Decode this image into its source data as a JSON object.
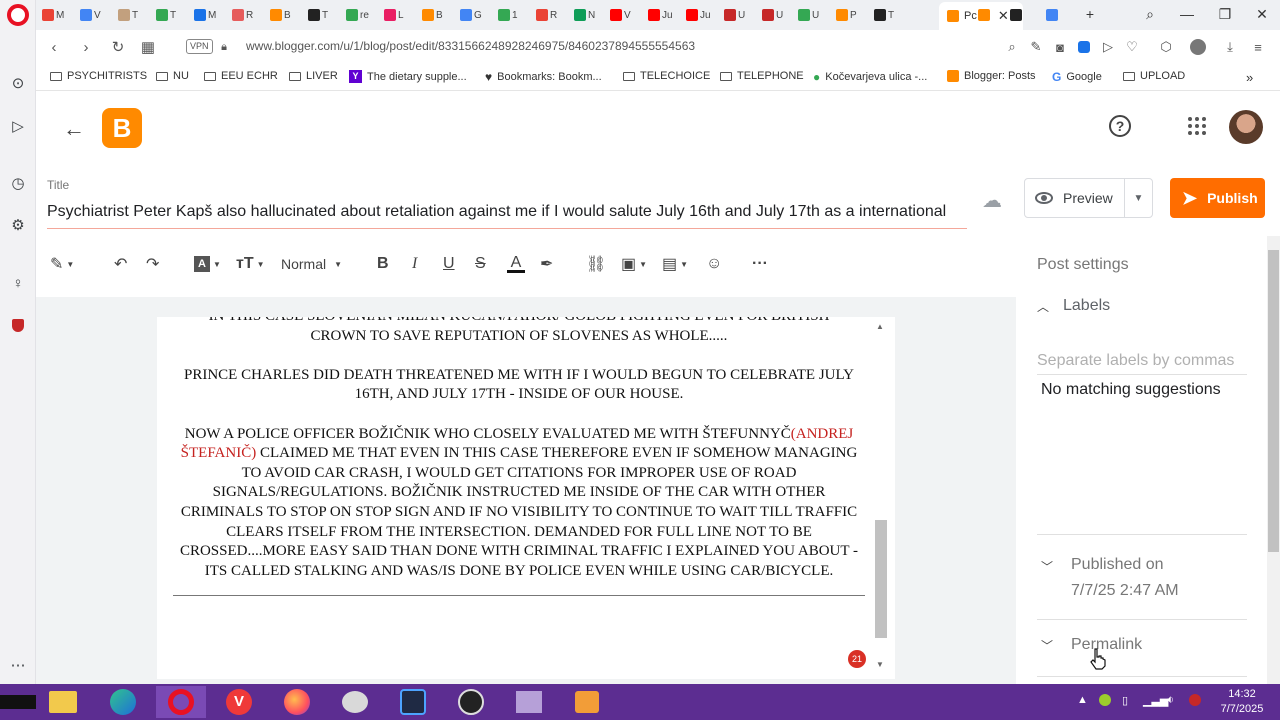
{
  "browser": {
    "active_tab_label": "Pc",
    "tab_short_labels": [
      "M",
      "V",
      "T",
      "T",
      "M",
      "R",
      "B",
      "T",
      "re",
      "L",
      "B",
      "G",
      "1",
      "R",
      "N",
      "V",
      "Ju",
      "Ju",
      "U",
      "U",
      "U",
      "P",
      "T"
    ],
    "url": "www.blogger.com/u/1/blog/post/edit/8331566248928246975/8460237894555554563",
    "vpn_label": "VPN",
    "bookmarks": [
      {
        "label": "PSYCHITRISTS",
        "icon": "folder-icon"
      },
      {
        "label": "NU",
        "icon": "folder-icon"
      },
      {
        "label": "EEU ECHR",
        "icon": "folder-icon"
      },
      {
        "label": "LIVER",
        "icon": "folder-icon"
      },
      {
        "label": "The dietary supple...",
        "icon": "yahoo-icon"
      },
      {
        "label": "Bookmarks: Bookm...",
        "icon": "heart-icon"
      },
      {
        "label": "TELECHOICE",
        "icon": "folder-icon"
      },
      {
        "label": "TELEPHONE",
        "icon": "folder-icon"
      },
      {
        "label": "Kočevarjeva ulica -...",
        "icon": "map-pin-icon"
      },
      {
        "label": "Blogger: Posts",
        "icon": "blogger-icon"
      },
      {
        "label": "Google",
        "icon": "google-icon"
      },
      {
        "label": "UPLOAD",
        "icon": "folder-icon"
      }
    ]
  },
  "editor": {
    "title_label": "Title",
    "post_title": "Psychiatrist Peter Kapš also hallucinated about retaliation against me if I would salute July 16th and July 17th as a international",
    "preview_label": "Preview",
    "publish_label": "Publish",
    "paragraph_style": "Normal",
    "content": {
      "p0_line1": "IN THIS CASE SLOVENIAN MILAN KUCAN/PAHOR/ GOLOB FIGHTING EVEN FOR BRITISH",
      "p0_line2": "CROWN TO SAVE REPUTATION OF SLOVENES AS WHOLE.....",
      "p1": "PRINCE CHARLES DID DEATH THREATENED ME WITH IF I WOULD BEGUN TO CELEBRATE JULY 16TH, AND JULY 17TH - INSIDE OF OUR HOUSE.",
      "p2_a": "NOW A POLICE OFFICER BOŽIČNIK WHO CLOSELY EVALUATED ME WITH ŠTEFUNNYČ",
      "p2_red": "(ANDREJ ŠTEFANIČ)",
      "p2_b": " CLAIMED ME THAT EVEN IN THIS CASE THEREFORE EVEN IF SOMEHOW MANAGING TO AVOID CAR CRASH, I WOULD GET CITATIONS FOR IMPROPER USE OF ROAD SIGNALS/REGULATIONS. BOŽIČNIK INSTRUCTED ME INSIDE OF THE CAR WITH OTHER CRIMINALS TO STOP ON STOP SIGN AND IF NO VISIBILITY TO CONTINUE TO WAIT TILL TRAFFIC CLEARS ITSELF FROM THE INTERSECTION. DEMANDED FOR FULL LINE NOT TO BE CROSSED....MORE EASY SAID THAN DONE WITH CRIMINAL TRAFFIC I EXPLAINED YOU ABOUT - ITS CALLED STALKING AND WAS/IS DONE BY POLICE EVEN WHILE USING CAR/BICYCLE."
    },
    "badge_count": "21"
  },
  "settings": {
    "header": "Post settings",
    "labels_title": "Labels",
    "labels_placeholder": "Separate labels by commas",
    "no_match": "No matching suggestions",
    "published_on_label": "Published on",
    "published_on_value": "7/7/25 2:47 AM",
    "permalink_label": "Permalink"
  },
  "taskbar": {
    "time": "14:32",
    "date": "7/7/2025"
  }
}
